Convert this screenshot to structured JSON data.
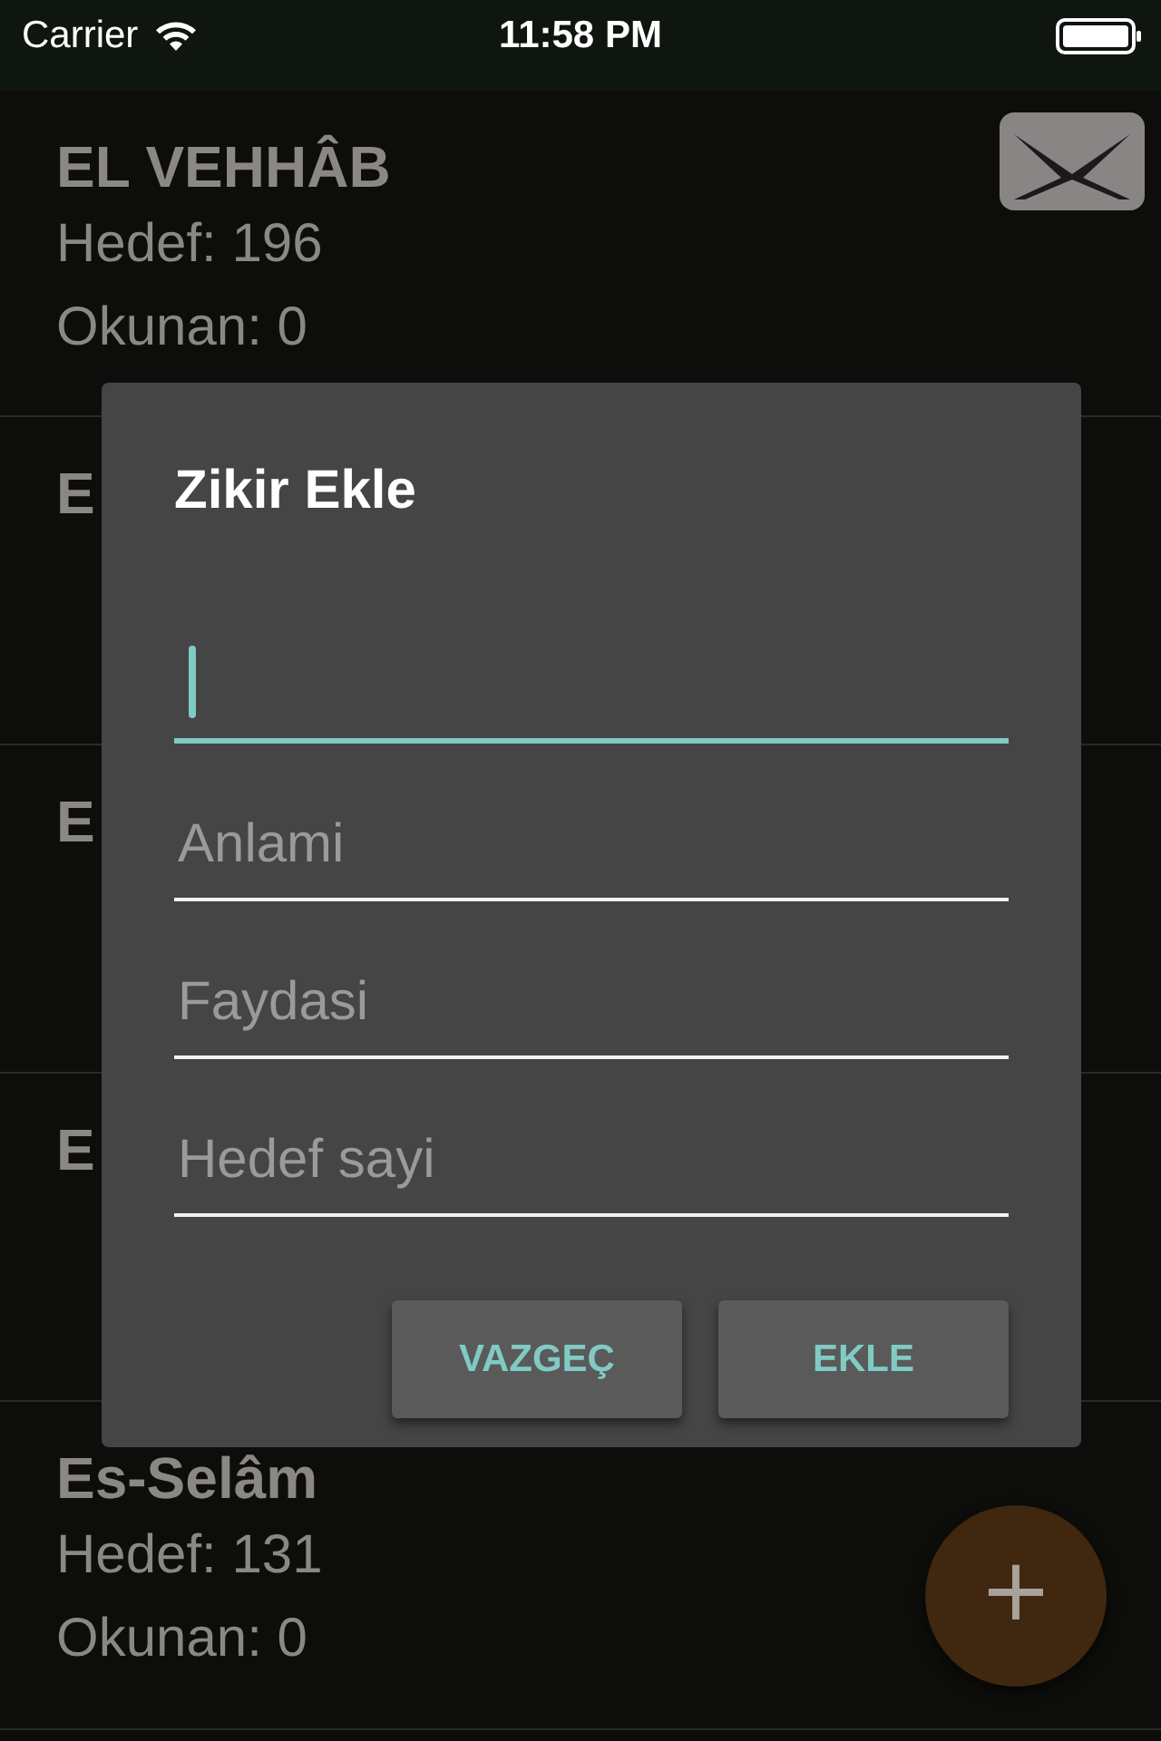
{
  "status_bar": {
    "carrier": "Carrier",
    "time": "11:58 PM"
  },
  "items": [
    {
      "title": "EL VEHHÂB",
      "target": "Hedef: 196",
      "read": "Okunan: 0"
    },
    {
      "title": "E"
    },
    {
      "title": "E"
    },
    {
      "title": "E"
    },
    {
      "title": "Es-Selâm",
      "target": "Hedef: 131",
      "read": "Okunan: 0"
    }
  ],
  "fab": "+",
  "dialog": {
    "title": "Zikir Ekle",
    "fields": [
      {
        "focused": true
      },
      {
        "placeholder": "Anlami",
        "focused": false
      },
      {
        "placeholder": "Faydasi",
        "focused": false
      },
      {
        "placeholder": "Hedef sayi",
        "focused": false
      }
    ],
    "buttons": [
      "VAZGEÇ",
      "EKLE"
    ]
  }
}
